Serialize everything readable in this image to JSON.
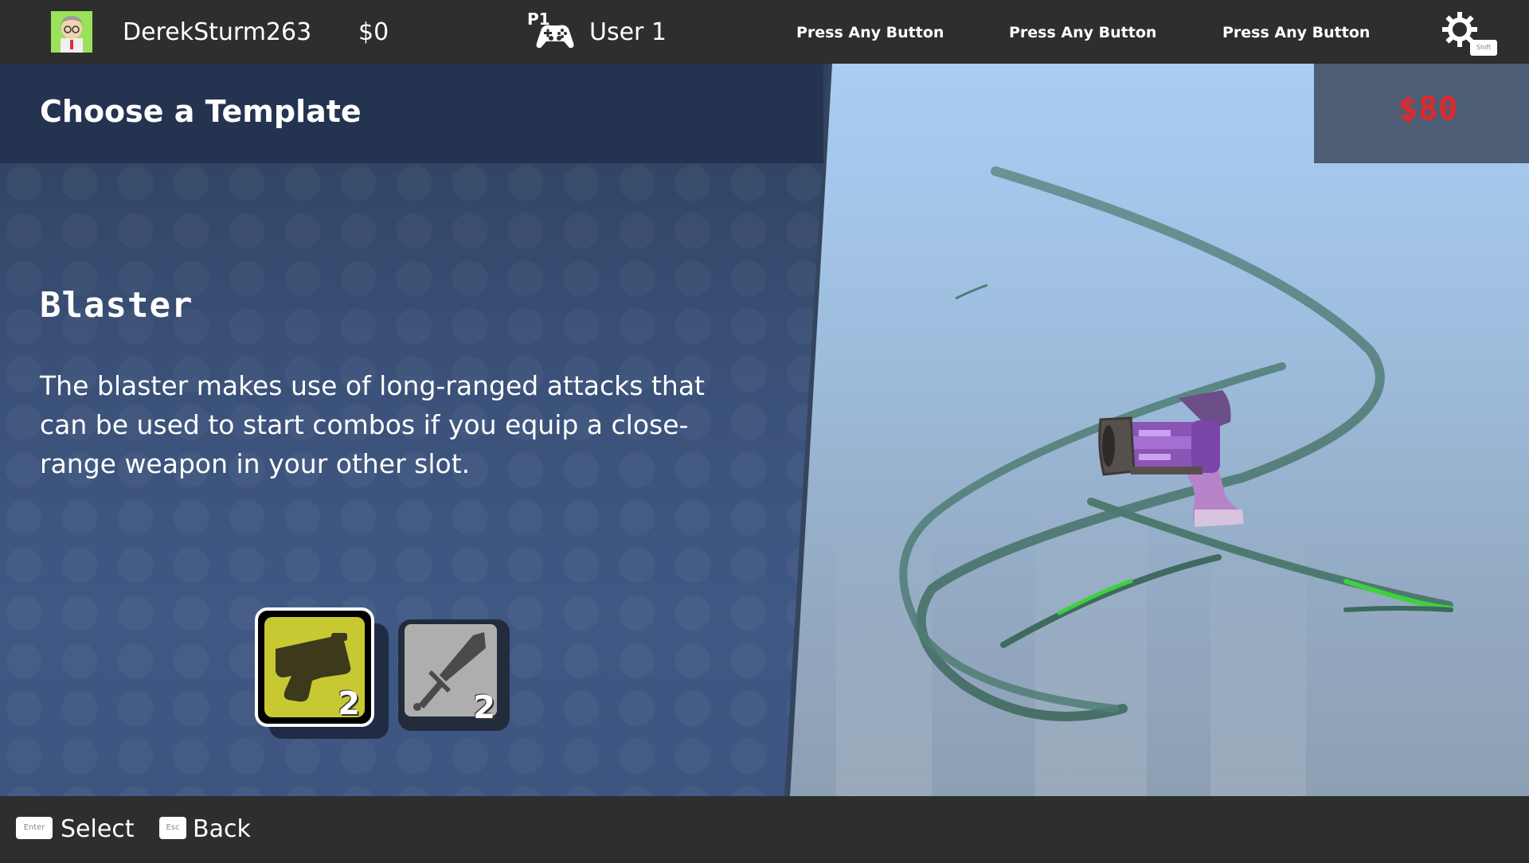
{
  "topbar": {
    "username": "DerekSturm263",
    "money": "$0",
    "player_tag": "P1",
    "user_label": "User 1",
    "press_slots": [
      "Press Any Button",
      "Press Any Button",
      "Press Any Button"
    ],
    "shift_key": "Shift"
  },
  "header": {
    "title": "Choose a Template"
  },
  "price": "$80",
  "weapon": {
    "name": "Blaster",
    "description": "The blaster makes use of long-ranged attacks that can be used to start combos if you equip a close-range weapon in your other slot."
  },
  "slots": [
    {
      "icon": "blaster-icon",
      "count": "2",
      "selected": true,
      "color": "#c8c932"
    },
    {
      "icon": "sword-icon",
      "count": "2",
      "selected": false,
      "color": "#aeaeae"
    }
  ],
  "bottombar": {
    "actions": [
      {
        "key": "Enter",
        "label": "Select"
      },
      {
        "key": "Esc",
        "label": "Back"
      }
    ]
  },
  "colors": {
    "price": "#e6262c",
    "accent_trail": "#4caf50"
  }
}
